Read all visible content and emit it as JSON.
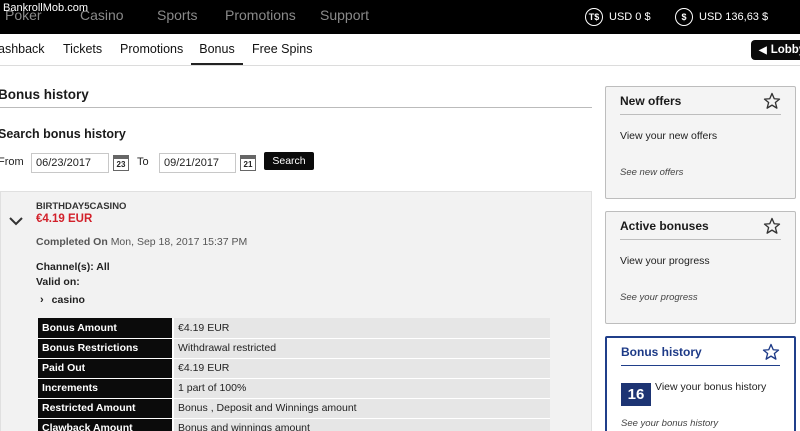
{
  "watermark": "BankrollMob.com",
  "topnav": {
    "items": [
      "Poker",
      "Casino",
      "Sports",
      "Promotions",
      "Support"
    ],
    "balances": [
      {
        "icon": "ticket-dollar-icon",
        "symbol": "T$",
        "label": "USD 0 $"
      },
      {
        "icon": "dollar-coin-icon",
        "symbol": "$",
        "label": "USD 136,63 $"
      }
    ]
  },
  "subnav": {
    "tabs": [
      "ashback",
      "Tickets",
      "Promotions",
      "Bonus",
      "Free Spins"
    ],
    "active_tab": "Bonus",
    "lobby_label": "Lobby"
  },
  "main": {
    "title": "Bonus history",
    "search": {
      "heading": "Search bonus history",
      "from_label": "From",
      "from_value": "06/23/2017",
      "from_cal_day": "23",
      "to_label": "To",
      "to_value": "09/21/2017",
      "to_cal_day": "21",
      "button_label": "Search"
    },
    "result": {
      "code": "BIRTHDAY5CASINO",
      "amount": "€4.19 EUR",
      "completed_label": "Completed On",
      "completed_value": "Mon, Sep 18, 2017 15:37 PM",
      "channels": "Channel(s): All",
      "valid_on": "Valid on:",
      "game": "casino",
      "details": [
        {
          "key": "Bonus Amount",
          "value": "€4.19 EUR"
        },
        {
          "key": "Bonus Restrictions",
          "value": "Withdrawal restricted"
        },
        {
          "key": "Paid Out",
          "value": "€4.19 EUR"
        },
        {
          "key": "Increments",
          "value": "1 part of 100%"
        },
        {
          "key": "Restricted Amount",
          "value": "Bonus , Deposit and Winnings amount"
        },
        {
          "key": "Clawback Amount",
          "value": "Bonus and winnings amount"
        }
      ]
    }
  },
  "sidebar": {
    "cards": [
      {
        "title": "New offers",
        "desc": "View your new offers",
        "link": "See new offers"
      },
      {
        "title": "Active bonuses",
        "desc": "View your progress",
        "link": "See your progress"
      },
      {
        "title": "Bonus history",
        "count": "16",
        "desc": "View your bonus history",
        "link": "See your bonus history"
      }
    ]
  },
  "colors": {
    "accent_red": "#d2202a",
    "active_blue": "#1d3a87",
    "nav_black": "#000000"
  }
}
